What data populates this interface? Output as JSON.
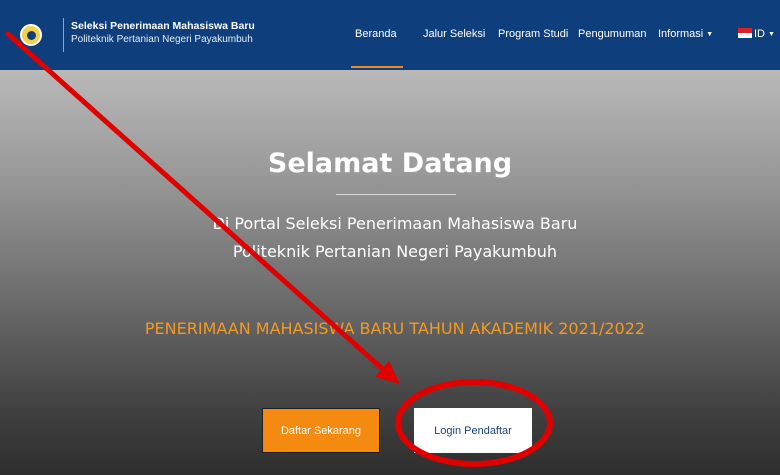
{
  "header": {
    "title": "Seleksi Penerimaan Mahasiswa Baru",
    "subtitle": "Politeknik Pertanian Negeri Payakumbuh",
    "logo_icon": "campus-seal-icon"
  },
  "nav": {
    "items": [
      {
        "label": "Beranda",
        "active": true
      },
      {
        "label": "Jalur Seleksi"
      },
      {
        "label": "Program Studi"
      },
      {
        "label": "Pengumuman"
      },
      {
        "label": "Informasi",
        "dropdown": true
      },
      {
        "label": "ID",
        "dropdown": true,
        "icon": "indonesia-flag-icon"
      }
    ]
  },
  "hero": {
    "title": "Selamat Datang",
    "description": "Di Portal Seleksi Penerimaan Mahasiswa Baru Politeknik Pertanian Negeri Payakumbuh",
    "year_line": "PENERIMAAN MAHASISWA BARU TAHUN AKADEMIK 2021/2022",
    "buttons": {
      "daftar": "Daftar Sekarang",
      "login": "Login Pendaftar"
    }
  },
  "annotations": {
    "arrow_color": "#e00000",
    "circle_color": "#e00000"
  },
  "colors": {
    "navbar": "#0e3f7c",
    "accent_orange": "#f58a11"
  }
}
